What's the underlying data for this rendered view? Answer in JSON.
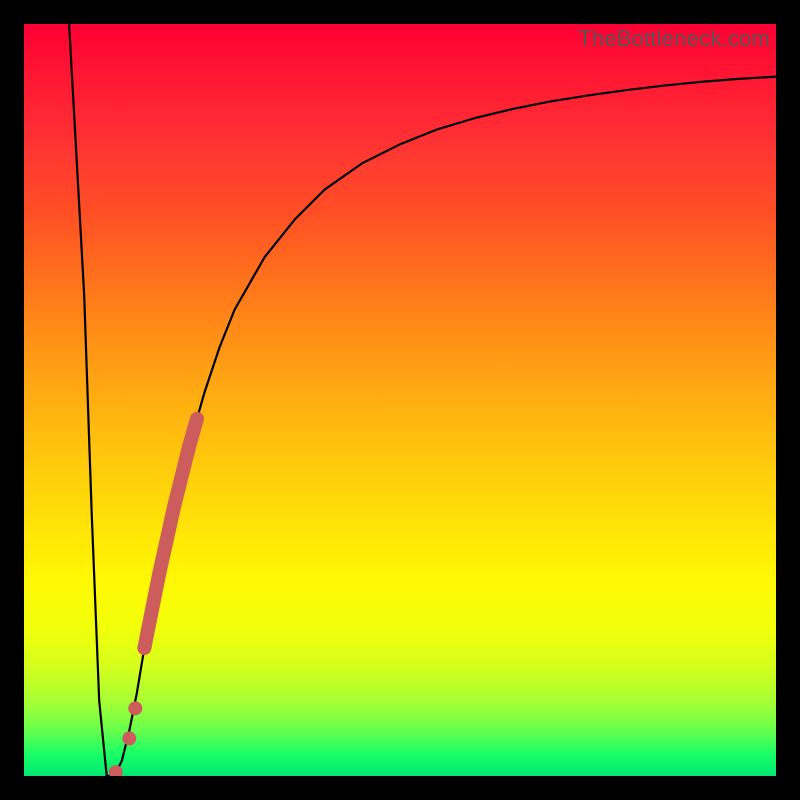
{
  "watermark": "TheBottleneck.com",
  "chart_data": {
    "type": "line",
    "title": "",
    "xlabel": "",
    "ylabel": "",
    "xlim": [
      0,
      100
    ],
    "ylim": [
      0,
      100
    ],
    "series": [
      {
        "name": "curve",
        "x": [
          6,
          8,
          9,
          10,
          11,
          12,
          13,
          14,
          15,
          16,
          18,
          20,
          22,
          24,
          26,
          28,
          32,
          36,
          40,
          45,
          50,
          55,
          60,
          65,
          70,
          75,
          80,
          85,
          90,
          95,
          100
        ],
        "y": [
          100,
          64,
          35,
          10,
          0,
          0,
          2,
          6,
          11,
          17,
          27,
          36,
          44,
          51,
          57,
          62,
          69,
          74,
          78,
          81.5,
          84,
          86,
          87.5,
          88.7,
          89.7,
          90.5,
          91.2,
          91.8,
          92.3,
          92.7,
          93
        ]
      }
    ],
    "highlight_segment": {
      "name": "thick-salmon-band",
      "x": [
        16.0,
        17.0,
        18.0,
        19.0,
        20.0,
        21.0,
        22.0,
        23.0
      ],
      "y": [
        17.0,
        22.0,
        27.0,
        31.5,
        36.0,
        40.0,
        44.0,
        47.5
      ]
    },
    "highlight_points": {
      "name": "salmon-dots",
      "points": [
        {
          "x": 14.8,
          "y": 9.0
        },
        {
          "x": 14.0,
          "y": 5.0
        },
        {
          "x": 12.2,
          "y": 0.5
        }
      ]
    },
    "colors": {
      "curve": "#000000",
      "highlight": "#cd5c5c",
      "background_top": "#ff0033",
      "background_bottom": "#00e873"
    }
  }
}
